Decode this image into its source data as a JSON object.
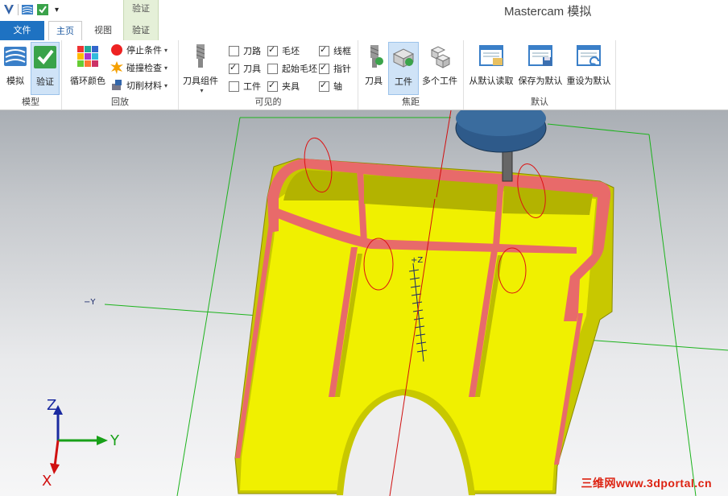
{
  "titlebar": {
    "app_title": "Mastercam 模拟",
    "context_tab_header": "验证"
  },
  "tabs": {
    "file": "文件",
    "home": "主页",
    "view": "视图",
    "verify": "验证"
  },
  "ribbon": {
    "model_group": {
      "label": "模型",
      "simulate": "模拟",
      "verify": "验证"
    },
    "playback_group": {
      "label": "回放",
      "cycle_color": "循环颜色",
      "stop_condition": "停止条件",
      "collision_check": "碰撞检查",
      "cut_material": "切削材料"
    },
    "visible_group": {
      "label": "可见的",
      "tool_assembly": "刀具组件",
      "checkboxes": [
        {
          "label": "刀路",
          "checked": false
        },
        {
          "label": "毛坯",
          "checked": true
        },
        {
          "label": "线框",
          "checked": true
        },
        {
          "label": "刀具",
          "checked": true
        },
        {
          "label": "起始毛坯",
          "checked": false
        },
        {
          "label": "指针",
          "checked": true
        },
        {
          "label": "工件",
          "checked": false
        },
        {
          "label": "夹具",
          "checked": true
        },
        {
          "label": "轴",
          "checked": true
        }
      ]
    },
    "focus_group": {
      "label": "焦距",
      "tool": "刀具",
      "workpiece": "工件",
      "multi_workpiece": "多个工件"
    },
    "default_group": {
      "label": "默认",
      "load_default": "从默认读取",
      "save_default": "保存为默认",
      "reset_default": "重设为默认"
    }
  },
  "viewport": {
    "axis_neg_y": "−Y",
    "axis_pos_z": "+Z",
    "triad": {
      "x": "X",
      "y": "Y",
      "z": "Z"
    },
    "watermark": "三维网www.3dportal.cn"
  },
  "colors": {
    "part_face": "#f0f000",
    "part_wall": "#c8c800",
    "part_top": "#e86a6a",
    "tool_holder": "#2e5a8a",
    "accent": "#1e72c2"
  }
}
